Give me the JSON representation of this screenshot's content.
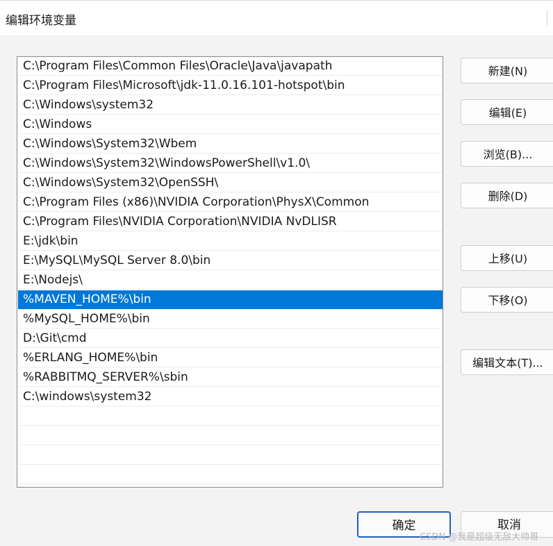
{
  "window": {
    "title": "编辑环境变量"
  },
  "list": {
    "items": [
      "C:\\Program Files\\Common Files\\Oracle\\Java\\javapath",
      "C:\\Program Files\\Microsoft\\jdk-11.0.16.101-hotspot\\bin",
      "C:\\Windows\\system32",
      "C:\\Windows",
      "C:\\Windows\\System32\\Wbem",
      "C:\\Windows\\System32\\WindowsPowerShell\\v1.0\\",
      "C:\\Windows\\System32\\OpenSSH\\",
      "C:\\Program Files (x86)\\NVIDIA Corporation\\PhysX\\Common",
      "C:\\Program Files\\NVIDIA Corporation\\NVIDIA NvDLISR",
      "E:\\jdk\\bin",
      "E:\\MySQL\\MySQL Server 8.0\\bin",
      "E:\\Nodejs\\",
      "%MAVEN_HOME%\\bin",
      "%MySQL_HOME%\\bin",
      "D:\\Git\\cmd",
      "%ERLANG_HOME%\\bin",
      "%RABBITMQ_SERVER%\\sbin",
      "C:\\windows\\system32"
    ],
    "selected_index": 12
  },
  "buttons": {
    "new": "新建(N)",
    "edit": "编辑(E)",
    "browse": "浏览(B)...",
    "delete": "删除(D)",
    "move_up": "上移(U)",
    "move_down": "下移(O)",
    "edit_text": "编辑文本(T)...",
    "ok": "确定",
    "cancel": "取消"
  },
  "watermark": "CSDN @我是超级无敌大帅哥",
  "colors": {
    "selection": "#0078d7",
    "default_button_border": "#1f5fbf"
  }
}
